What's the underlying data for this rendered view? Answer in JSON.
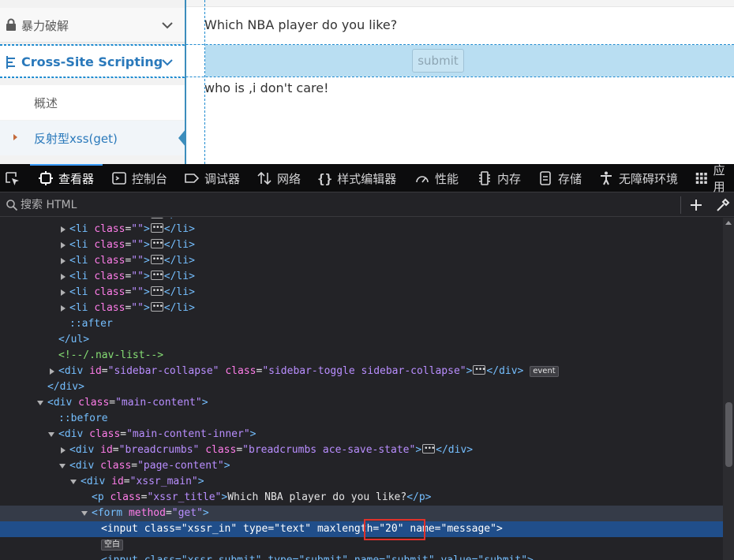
{
  "page": {
    "sidebar": {
      "brute_force": "暴力破解",
      "xss_section": "Cross-Site Scripting",
      "overview": "概述",
      "reflected_get": "反射型xss(get)"
    },
    "main": {
      "question": "Which NBA player do you like?",
      "submit_label": "submit",
      "answer": "who is ,i don't care!"
    }
  },
  "devtools": {
    "tabs": [
      {
        "label": "查看器",
        "icon": "inspector-icon"
      },
      {
        "label": "控制台",
        "icon": "console-icon"
      },
      {
        "label": "调试器",
        "icon": "debugger-icon"
      },
      {
        "label": "网络",
        "icon": "network-icon"
      },
      {
        "label": "样式编辑器",
        "icon": "style-editor-icon"
      },
      {
        "label": "性能",
        "icon": "performance-icon"
      },
      {
        "label": "内存",
        "icon": "memory-icon"
      },
      {
        "label": "存储",
        "icon": "storage-icon"
      },
      {
        "label": "无障碍环境",
        "icon": "accessibility-icon"
      },
      {
        "label": "应用",
        "icon": "application-icon"
      }
    ],
    "search_placeholder": "搜索 HTML",
    "tree": {
      "li": "li",
      "class_attr": "class",
      "empty_val": "\"\"",
      "after": "::after",
      "before": "::before",
      "ul_close": "</ul>",
      "div_close": "</div>",
      "comment": "<!--/.nav-list-->",
      "sidebar_collapse_id": "\"sidebar-collapse\"",
      "sidebar_collapse_class": "\"sidebar-toggle sidebar-collapse\"",
      "event_badge": "event",
      "main_content": "\"main-content\"",
      "main_content_inner": "\"main-content-inner\"",
      "breadcrumbs_id": "\"breadcrumbs\"",
      "breadcrumbs_class": "\"breadcrumbs ace-save-state\"",
      "page_content": "\"page-content\"",
      "xssr_main": "\"xssr_main\"",
      "xssr_title": "\"xssr_title\"",
      "p_text": "Which NBA player do you like?",
      "form_method": "\"get\"",
      "input_class": "\"xssr_in\"",
      "input_type": "\"text\"",
      "input_maxlength": "\"20\"",
      "input_name": "\"message\"",
      "whitespace_badge": "空白",
      "last_line": "<input class=\"xssr_submit\" type=\"submit\" name=\"submit\" value=\"submit\">"
    }
  },
  "colors": {
    "accent": "#3c8dbc",
    "selection": "#204e8a",
    "highlight_box": "#e0312b"
  }
}
